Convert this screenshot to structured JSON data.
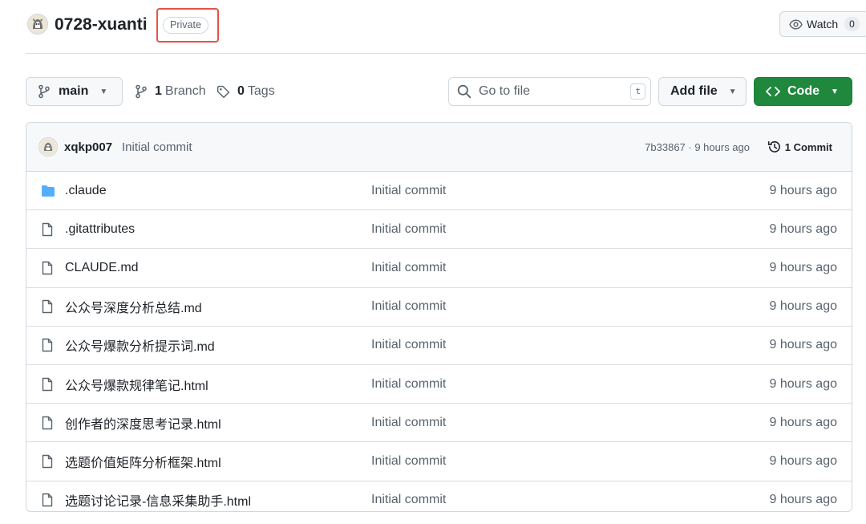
{
  "header": {
    "repo_name": "0728-xuanti",
    "visibility_badge": "Private",
    "watch_label": "Watch",
    "watch_count": "0"
  },
  "toolbar": {
    "branch_name": "main",
    "branch_count": "1",
    "branch_label": "Branch",
    "tag_count": "0",
    "tag_label": "Tags",
    "search_placeholder": "Go to file",
    "search_shortcut": "t",
    "add_file_label": "Add file",
    "code_label": "Code"
  },
  "latest_commit": {
    "author": "xqkp007",
    "message": "Initial commit",
    "hash_and_time": "7b33867 · 9 hours ago",
    "commit_count_label": "1 Commit"
  },
  "files": [
    {
      "type": "folder",
      "name": ".claude",
      "message": "Initial commit",
      "age": "9 hours ago"
    },
    {
      "type": "file",
      "name": ".gitattributes",
      "message": "Initial commit",
      "age": "9 hours ago"
    },
    {
      "type": "file",
      "name": "CLAUDE.md",
      "message": "Initial commit",
      "age": "9 hours ago"
    },
    {
      "type": "file",
      "name": "公众号深度分析总结.md",
      "message": "Initial commit",
      "age": "9 hours ago"
    },
    {
      "type": "file",
      "name": "公众号爆款分析提示词.md",
      "message": "Initial commit",
      "age": "9 hours ago"
    },
    {
      "type": "file",
      "name": "公众号爆款规律笔记.html",
      "message": "Initial commit",
      "age": "9 hours ago"
    },
    {
      "type": "file",
      "name": "创作者的深度思考记录.html",
      "message": "Initial commit",
      "age": "9 hours ago"
    },
    {
      "type": "file",
      "name": "选题价值矩阵分析框架.html",
      "message": "Initial commit",
      "age": "9 hours ago"
    },
    {
      "type": "file",
      "name": "选题讨论记录-信息采集助手.html",
      "message": "Initial commit",
      "age": "9 hours ago"
    }
  ],
  "colors": {
    "accent_green": "#1f883d",
    "highlight_red": "#e5534b",
    "folder_blue": "#54aeff"
  }
}
